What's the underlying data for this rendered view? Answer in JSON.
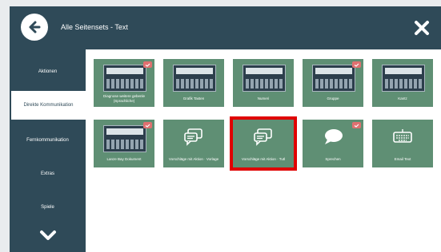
{
  "window": {
    "title": "Alle Seitensets - Text",
    "background": "#2f4a58"
  },
  "sidebar": {
    "items": [
      {
        "label": "Aktionen"
      },
      {
        "label": "Direkte Kommunikation"
      },
      {
        "label": "Fernkommunikation"
      },
      {
        "label": "Extras"
      },
      {
        "label": "Spiele"
      }
    ],
    "active_index": 1
  },
  "grid": {
    "tiles": [
      {
        "label": "Diagnose weitere gebenle (Sprachliche)",
        "icon": "keyboard-thumbnail-icon",
        "badge": true
      },
      {
        "label": "Grafik Tasten",
        "icon": "keyboard-thumbnail-icon",
        "badge": false
      },
      {
        "label": "Numeri",
        "icon": "keyboard-thumbnail-icon",
        "badge": false
      },
      {
        "label": "Gruppe",
        "icon": "keyboard-thumbnail-icon",
        "badge": true
      },
      {
        "label": "Kantz",
        "icon": "keyboard-thumbnail-icon",
        "badge": false
      },
      {
        "label": "Lanze Bay Dokument",
        "icon": "keyboard-thumbnail-icon",
        "badge": true
      },
      {
        "label": "Vorschläge mit Aktion · Vorlage",
        "icon": "chat-bubbles-icon",
        "badge": false
      },
      {
        "label": "Vorschläge mit Aktion · Tutl",
        "icon": "chat-bubbles-icon",
        "badge": false
      },
      {
        "label": "Sprechen",
        "icon": "speech-bubble-icon",
        "badge": true
      },
      {
        "label": "Email Text",
        "icon": "keyboard-device-icon",
        "badge": false
      }
    ],
    "selected_index": 7,
    "tile_color": "#5f8f74",
    "highlight_color": "#e00000"
  }
}
